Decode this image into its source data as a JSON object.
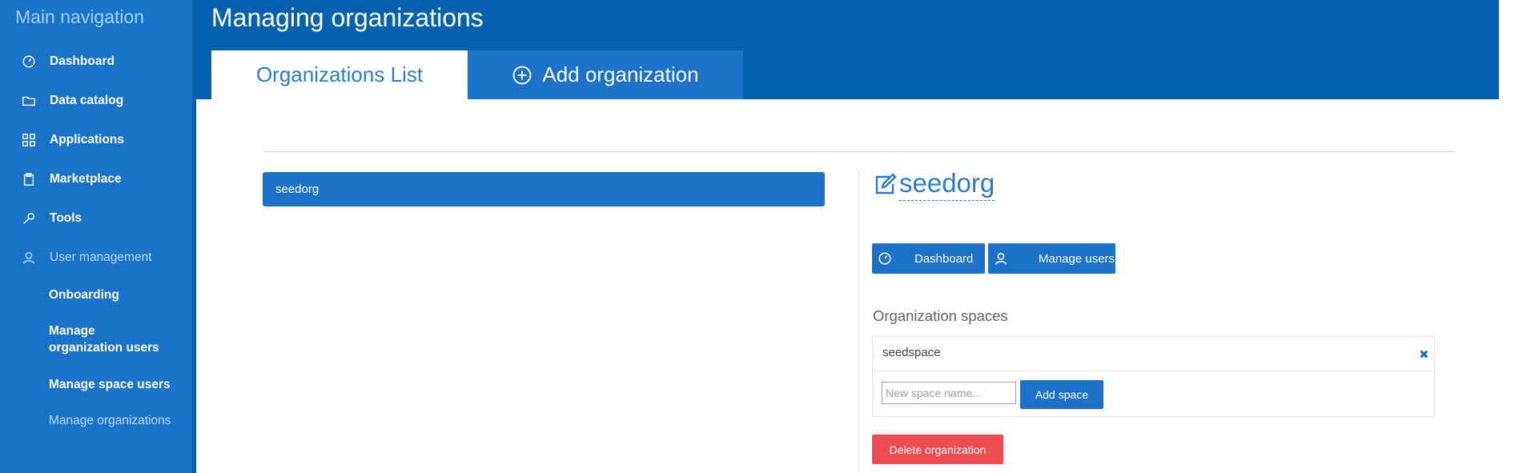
{
  "sidebar": {
    "title": "Main navigation",
    "items": [
      {
        "label": "Dashboard",
        "icon": "dashboard-icon"
      },
      {
        "label": "Data catalog",
        "icon": "folder-icon"
      },
      {
        "label": "Applications",
        "icon": "grid-icon"
      },
      {
        "label": "Marketplace",
        "icon": "clipboard-icon"
      },
      {
        "label": "Tools",
        "icon": "wrench-icon"
      },
      {
        "label": "User management",
        "icon": "user-icon"
      }
    ],
    "subitems": [
      {
        "label": "Onboarding"
      },
      {
        "label": "Manage organization users"
      },
      {
        "label": "Manage space users"
      },
      {
        "label": "Manage organizations"
      }
    ]
  },
  "header": {
    "title": "Managing organizations",
    "tabs": [
      {
        "label": "Organizations List"
      },
      {
        "label": "Add organization",
        "icon": "plus-circle-icon"
      }
    ]
  },
  "list": {
    "organizations": [
      {
        "name": "seedorg"
      }
    ]
  },
  "detail": {
    "org_name": "seedorg",
    "buttons": {
      "dashboard": "Dashboard",
      "manage_users": "Manage users"
    },
    "spaces_title": "Organization spaces",
    "spaces": [
      {
        "name": "seedspace"
      }
    ],
    "new_space_placeholder": "New space name...",
    "add_space_label": "Add space",
    "delete_label": "Delete organization"
  },
  "colors": {
    "sidebar": "#1873c9",
    "header": "#0561ad",
    "accent": "#1b72c8",
    "danger": "#ee4c50"
  }
}
